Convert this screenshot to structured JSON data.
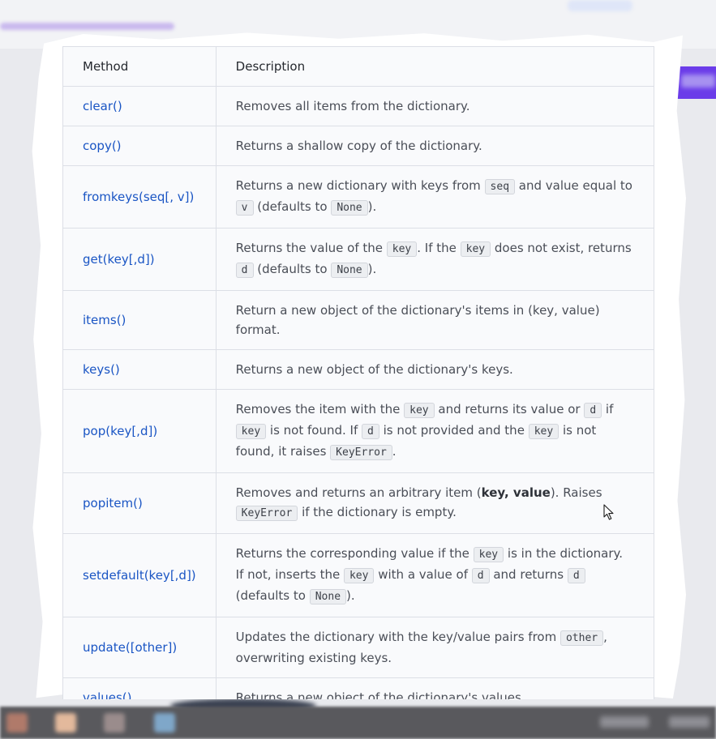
{
  "table": {
    "headers": [
      "Method",
      "Description"
    ],
    "rows": [
      {
        "method": "clear()",
        "desc": [
          {
            "t": "Removes all items from the dictionary."
          }
        ]
      },
      {
        "method": "copy()",
        "desc": [
          {
            "t": "Returns a shallow copy of the dictionary."
          }
        ]
      },
      {
        "method": "fromkeys(seq[, v])",
        "desc": [
          {
            "t": "Returns a new dictionary with keys from "
          },
          {
            "c": "seq"
          },
          {
            "t": " and value equal to "
          },
          {
            "c": "v"
          },
          {
            "t": " (defaults to "
          },
          {
            "c": "None"
          },
          {
            "t": ")."
          }
        ]
      },
      {
        "method": "get(key[,d])",
        "desc": [
          {
            "t": "Returns the value of the "
          },
          {
            "c": "key"
          },
          {
            "t": ". If the "
          },
          {
            "c": "key"
          },
          {
            "t": " does not exist, returns "
          },
          {
            "c": "d"
          },
          {
            "t": " (defaults to "
          },
          {
            "c": "None"
          },
          {
            "t": ")."
          }
        ]
      },
      {
        "method": "items()",
        "desc": [
          {
            "t": "Return a new object of the dictionary's items in (key, value) format."
          }
        ]
      },
      {
        "method": "keys()",
        "desc": [
          {
            "t": "Returns a new object of the dictionary's keys."
          }
        ]
      },
      {
        "method": "pop(key[,d])",
        "desc": [
          {
            "t": "Removes the item with the "
          },
          {
            "c": "key"
          },
          {
            "t": " and returns its value or "
          },
          {
            "c": "d"
          },
          {
            "t": " if "
          },
          {
            "c": "key"
          },
          {
            "t": " is not found. If "
          },
          {
            "c": "d"
          },
          {
            "t": " is not provided and the "
          },
          {
            "c": "key"
          },
          {
            "t": " is not found, it raises "
          },
          {
            "c": "KeyError"
          },
          {
            "t": "."
          }
        ]
      },
      {
        "method": "popitem()",
        "desc": [
          {
            "t": "Removes and returns an arbitrary item ("
          },
          {
            "b": "key, value"
          },
          {
            "t": "). Raises "
          },
          {
            "c": "KeyError"
          },
          {
            "t": " if the dictionary is empty."
          }
        ]
      },
      {
        "method": "setdefault(key[,d])",
        "desc": [
          {
            "t": "Returns the corresponding value if the "
          },
          {
            "c": "key"
          },
          {
            "t": " is in the dictionary. If not, inserts the "
          },
          {
            "c": "key"
          },
          {
            "t": " with a value of "
          },
          {
            "c": "d"
          },
          {
            "t": " and returns "
          },
          {
            "c": "d"
          },
          {
            "t": " (defaults to "
          },
          {
            "c": "None"
          },
          {
            "t": ")."
          }
        ]
      },
      {
        "method": "update([other])",
        "desc": [
          {
            "t": "Updates the dictionary with the key/value pairs from "
          },
          {
            "c": "other"
          },
          {
            "t": ", overwriting existing keys."
          }
        ]
      },
      {
        "method": "values()",
        "desc": [
          {
            "t": "Returns a new object of the dictionary's values"
          }
        ]
      }
    ]
  },
  "colors": {
    "method_link": "#1a55c4",
    "accent_button": "#6b3ce9",
    "progress": "#c9b9ee"
  },
  "icons": {
    "cursor": "mouse-pointer-icon"
  }
}
